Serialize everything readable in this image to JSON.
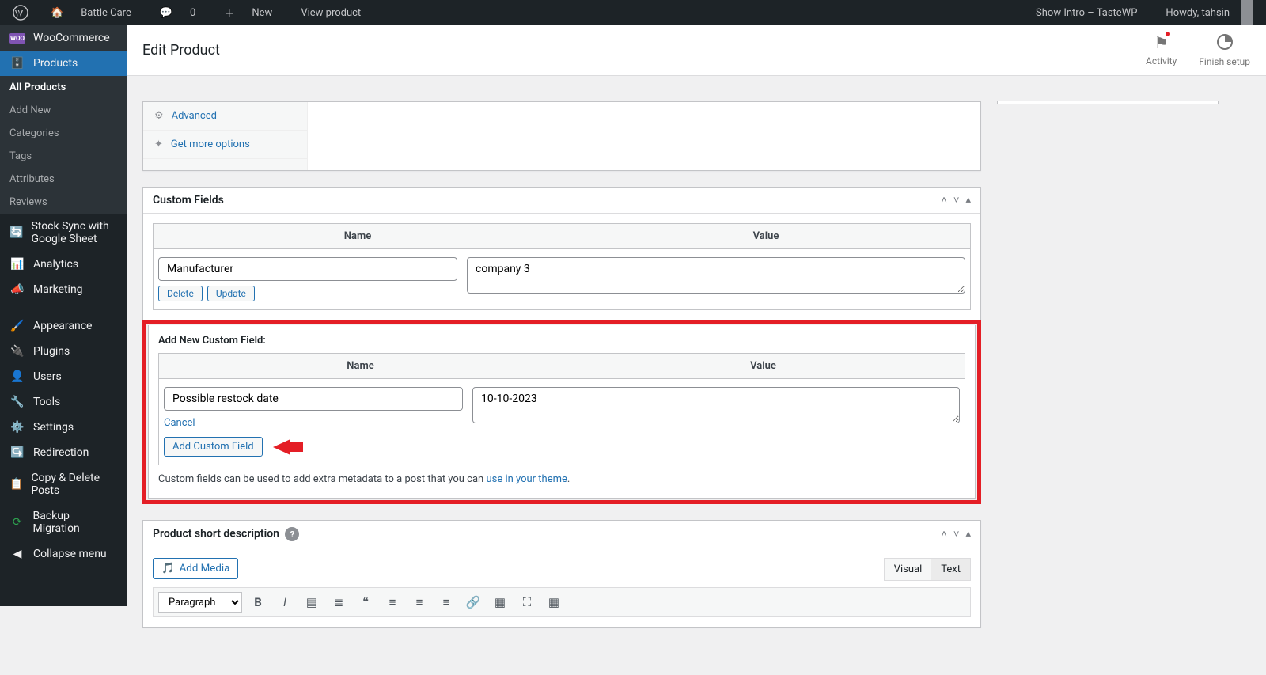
{
  "adminbar": {
    "site": "Battle Care",
    "comments": "0",
    "new": "New",
    "view": "View product",
    "intro": "Show Intro – TasteWP",
    "howdy": "Howdy, tahsin"
  },
  "sidebar": {
    "woo": "WooCommerce",
    "products": "Products",
    "sub": {
      "all": "All Products",
      "addnew": "Add New",
      "cats": "Categories",
      "tags": "Tags",
      "attrs": "Attributes",
      "reviews": "Reviews"
    },
    "stock": "Stock Sync with Google Sheet",
    "analytics": "Analytics",
    "marketing": "Marketing",
    "appearance": "Appearance",
    "plugins": "Plugins",
    "users": "Users",
    "tools": "Tools",
    "settings": "Settings",
    "redirection": "Redirection",
    "copy": "Copy & Delete Posts",
    "backup": "Backup Migration",
    "collapse": "Collapse menu"
  },
  "header": {
    "title": "Edit Product",
    "activity": "Activity",
    "finish": "Finish setup"
  },
  "pdtabs": {
    "advanced": "Advanced",
    "getmore": "Get more options"
  },
  "cf": {
    "title": "Custom Fields",
    "name_h": "Name",
    "value_h": "Value",
    "row1_name": "Manufacturer",
    "row1_value": "company 3",
    "delete": "Delete",
    "update": "Update",
    "addnew_heading": "Add New Custom Field:",
    "new_name": "Possible restock date",
    "new_value": "10-10-2023",
    "cancel": "Cancel",
    "add_btn": "Add Custom Field",
    "help_pre": "Custom fields can be used to add extra metadata to a post that you can ",
    "help_link": "use in your theme",
    "help_post": "."
  },
  "shortdesc": {
    "title": "Product short description",
    "addmedia": "Add Media",
    "visual": "Visual",
    "text": "Text",
    "format": "Paragraph"
  }
}
